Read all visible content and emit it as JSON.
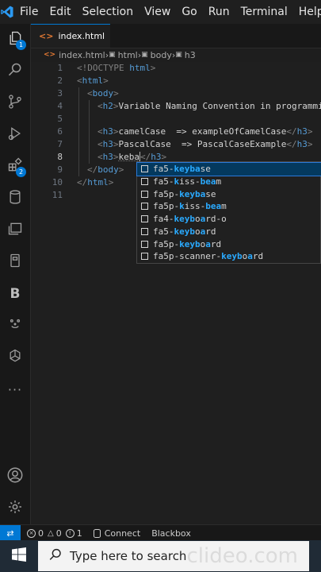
{
  "menu": [
    "File",
    "Edit",
    "Selection",
    "View",
    "Go",
    "Run",
    "Terminal",
    "Help"
  ],
  "activity_badges": {
    "explorer": "1",
    "extensions": "2"
  },
  "tab": {
    "label": "index.html"
  },
  "breadcrumb": [
    "index.html",
    "html",
    "body",
    "h3"
  ],
  "line_numbers": [
    "1",
    "2",
    "3",
    "4",
    "5",
    "6",
    "7",
    "8",
    "9",
    "10",
    "11"
  ],
  "code": {
    "l1_a": "<!DOCTYPE ",
    "l1_b": "html",
    "l1_c": ">",
    "l2_a": "<",
    "l2_b": "html",
    "l2_c": ">",
    "l3_a": "<",
    "l3_b": "body",
    "l3_c": ">",
    "l4_a": "<",
    "l4_b": "h2",
    "l4_c": ">",
    "l4_text": "Variable Naming Convention in programming",
    "l6_a": "<",
    "l6_b": "h3",
    "l6_c": ">",
    "l6_text": "camelCase  => exampleOfCamelCase",
    "l6_d": "</",
    "l6_e": "h3",
    "l6_f": ">",
    "l7_a": "<",
    "l7_b": "h3",
    "l7_c": ">",
    "l7_text": "PascalCase  => PascalCaseExample",
    "l7_d": "</",
    "l7_e": "h3",
    "l7_f": ">",
    "l8_a": "<",
    "l8_b": "h3",
    "l8_c": ">",
    "l8_text": "keba",
    "l8_d": "</",
    "l8_e": "h3",
    "l8_f": ">",
    "l9_a": "</",
    "l9_b": "body",
    "l9_c": ">",
    "l10_a": "</",
    "l10_b": "html",
    "l10_c": ">"
  },
  "suggestions": [
    {
      "pre": "fa5-",
      "hl": "keyba",
      "post": "se"
    },
    {
      "pre": "fa5-",
      "hl": "k",
      "mid": "iss-",
      "hl2": "bea",
      "post": "m"
    },
    {
      "pre": "fa5p-",
      "hl": "keyba",
      "post": "se"
    },
    {
      "pre": "fa5p-",
      "hl": "k",
      "mid": "iss-",
      "hl2": "bea",
      "post": "m"
    },
    {
      "pre": "fa4-",
      "hl": "keyb",
      "mid": "o",
      "hl2": "a",
      "post": "rd-o"
    },
    {
      "pre": "fa5-",
      "hl": "keyb",
      "mid": "o",
      "hl2": "a",
      "post": "rd"
    },
    {
      "pre": "fa5p-",
      "hl": "keyb",
      "mid": "o",
      "hl2": "a",
      "post": "rd"
    },
    {
      "pre": "fa5p-scanner-",
      "hl": "keyb",
      "mid": "o",
      "hl2": "a",
      "post": "rd"
    }
  ],
  "status": {
    "errors": "0",
    "warnings": "0",
    "info": "1",
    "connect": "Connect",
    "blackbox": "Blackbox"
  },
  "taskbar": {
    "search_placeholder": "Type here to search"
  },
  "watermark": "clideo.com",
  "colors": {
    "accent": "#0078d4",
    "tag": "#569cd6",
    "match": "#2aaaff"
  }
}
